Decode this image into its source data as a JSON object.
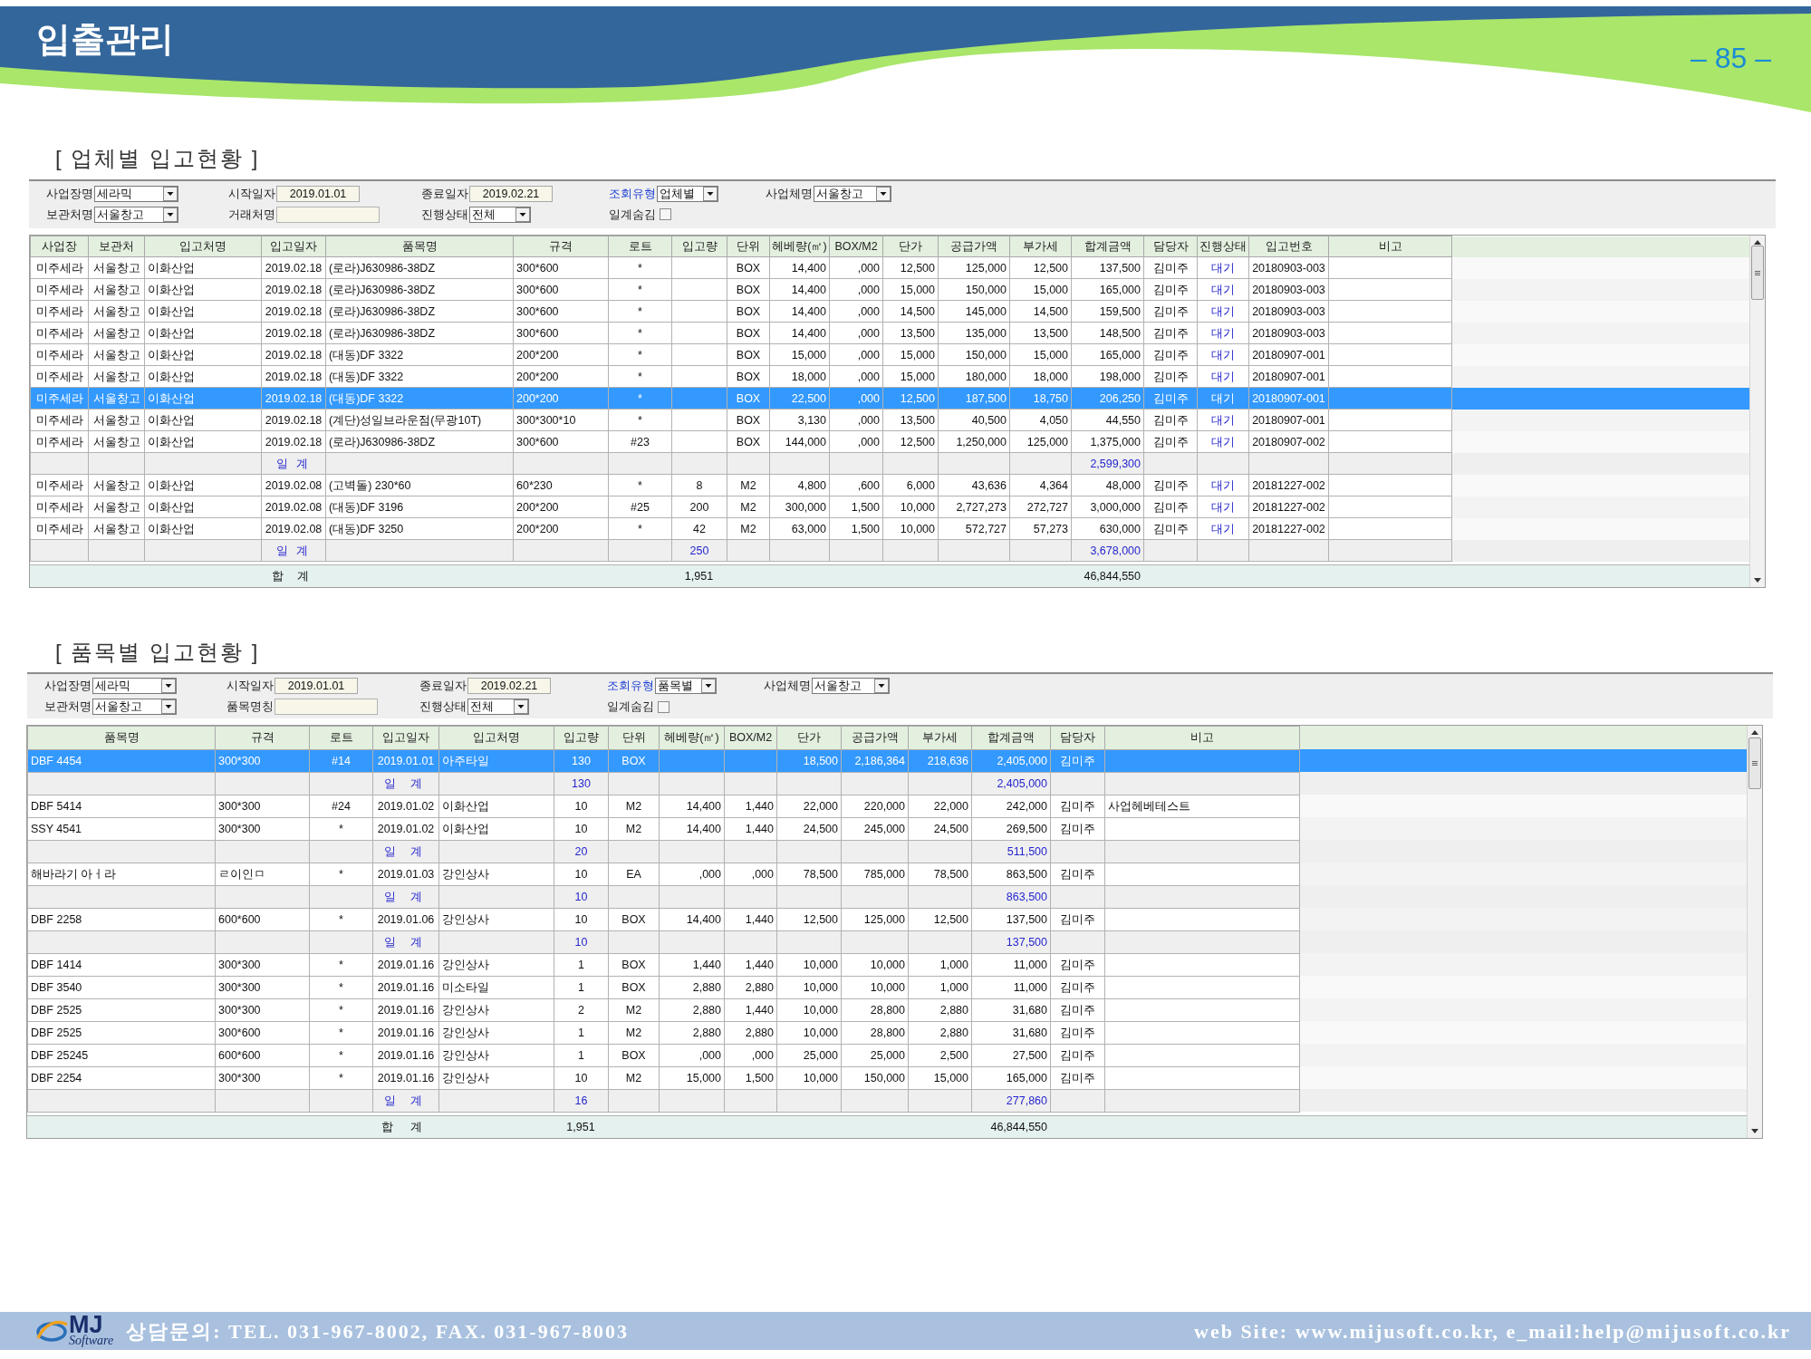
{
  "header": {
    "title": "입출관리",
    "page_number": "– 85 –"
  },
  "sections": [
    {
      "title": "[ 업체별 입고현황 ]",
      "filter_rows": [
        [
          {
            "label": "사업장명",
            "link": false,
            "kind": "select",
            "value": "세라믹"
          },
          {
            "label": "시작일자",
            "link": false,
            "kind": "date",
            "value": "2019.01.01"
          },
          {
            "label": "종료일자",
            "link": false,
            "kind": "date",
            "value": "2019.02.21"
          },
          {
            "label": "조회유형",
            "link": true,
            "kind": "select",
            "value": "업체별"
          },
          {
            "label": "사업체명",
            "link": false,
            "kind": "select",
            "value": "서울창고"
          }
        ],
        [
          {
            "label": "보관처명",
            "link": false,
            "kind": "select",
            "value": "서울창고"
          },
          {
            "label": "거래처명",
            "link": false,
            "kind": "text"
          },
          {
            "label": "진행상태",
            "link": false,
            "kind": "select",
            "value": "전체"
          },
          {
            "label": "일계숨김",
            "link": false,
            "kind": "checkbox",
            "checked": false
          }
        ]
      ],
      "table": {
        "columns": {
          "site": "사업장",
          "warehouse": "보관처",
          "supplier": "입고처명",
          "date": "입고일자",
          "item": "품목명",
          "spec": "규격",
          "lot": "로트",
          "qty": "입고량",
          "unit": "단위",
          "area": "헤베량(㎡)",
          "box_m2": "BOX/M2",
          "unit_price": "단가",
          "supply_amount": "공급가액",
          "vat": "부가세",
          "total_amount": "합계금액",
          "manager": "담당자",
          "status": "진행상태",
          "receipt_no": "입고번호",
          "note": "비고"
        },
        "rows": [
          {
            "kind": "item",
            "selected": false,
            "cells": {
              "site": "미주세라",
              "warehouse": "서울창고",
              "supplier": "이화산업",
              "date": "2019.02.18",
              "item": "(로라)J630986-38DZ",
              "spec": "300*600",
              "lot": "*",
              "unit": "BOX",
              "area": "14,400",
              "box_m2": ",000",
              "unit_price": "12,500",
              "supply_amount": "125,000",
              "vat": "12,500",
              "total_amount": "137,500",
              "manager": "김미주",
              "status": "대기",
              "receipt_no": "20180903-003"
            }
          },
          {
            "kind": "item",
            "selected": false,
            "cells": {
              "site": "미주세라",
              "warehouse": "서울창고",
              "supplier": "이화산업",
              "date": "2019.02.18",
              "item": "(로라)J630986-38DZ",
              "spec": "300*600",
              "lot": "*",
              "unit": "BOX",
              "area": "14,400",
              "box_m2": ",000",
              "unit_price": "15,000",
              "supply_amount": "150,000",
              "vat": "15,000",
              "total_amount": "165,000",
              "manager": "김미주",
              "status": "대기",
              "receipt_no": "20180903-003"
            }
          },
          {
            "kind": "item",
            "selected": false,
            "cells": {
              "site": "미주세라",
              "warehouse": "서울창고",
              "supplier": "이화산업",
              "date": "2019.02.18",
              "item": "(로라)J630986-38DZ",
              "spec": "300*600",
              "lot": "*",
              "unit": "BOX",
              "area": "14,400",
              "box_m2": ",000",
              "unit_price": "14,500",
              "supply_amount": "145,000",
              "vat": "14,500",
              "total_amount": "159,500",
              "manager": "김미주",
              "status": "대기",
              "receipt_no": "20180903-003"
            }
          },
          {
            "kind": "item",
            "selected": false,
            "cells": {
              "site": "미주세라",
              "warehouse": "서울창고",
              "supplier": "이화산업",
              "date": "2019.02.18",
              "item": "(로라)J630986-38DZ",
              "spec": "300*600",
              "lot": "*",
              "unit": "BOX",
              "area": "14,400",
              "box_m2": ",000",
              "unit_price": "13,500",
              "supply_amount": "135,000",
              "vat": "13,500",
              "total_amount": "148,500",
              "manager": "김미주",
              "status": "대기",
              "receipt_no": "20180903-003"
            }
          },
          {
            "kind": "item",
            "selected": false,
            "cells": {
              "site": "미주세라",
              "warehouse": "서울창고",
              "supplier": "이화산업",
              "date": "2019.02.18",
              "item": "(대동)DF 3322",
              "spec": "200*200",
              "lot": "*",
              "unit": "BOX",
              "area": "15,000",
              "box_m2": ",000",
              "unit_price": "15,000",
              "supply_amount": "150,000",
              "vat": "15,000",
              "total_amount": "165,000",
              "manager": "김미주",
              "status": "대기",
              "receipt_no": "20180907-001"
            }
          },
          {
            "kind": "item",
            "selected": false,
            "cells": {
              "site": "미주세라",
              "warehouse": "서울창고",
              "supplier": "이화산업",
              "date": "2019.02.18",
              "item": "(대동)DF 3322",
              "spec": "200*200",
              "lot": "*",
              "unit": "BOX",
              "area": "18,000",
              "box_m2": ",000",
              "unit_price": "15,000",
              "supply_amount": "180,000",
              "vat": "18,000",
              "total_amount": "198,000",
              "manager": "김미주",
              "status": "대기",
              "receipt_no": "20180907-001"
            }
          },
          {
            "kind": "item",
            "selected": true,
            "cells": {
              "site": "미주세라",
              "warehouse": "서울창고",
              "supplier": "이화산업",
              "date": "2019.02.18",
              "item": "(대동)DF 3322",
              "spec": "200*200",
              "lot": "*",
              "unit": "BOX",
              "area": "22,500",
              "box_m2": ",000",
              "unit_price": "12,500",
              "supply_amount": "187,500",
              "vat": "18,750",
              "total_amount": "206,250",
              "manager": "김미주",
              "status": "대기",
              "receipt_no": "20180907-001"
            }
          },
          {
            "kind": "item",
            "selected": false,
            "cells": {
              "site": "미주세라",
              "warehouse": "서울창고",
              "supplier": "이화산업",
              "date": "2019.02.18",
              "item": "(계단)성일브라운점(무광10T)",
              "spec": "300*300*10",
              "lot": "*",
              "unit": "BOX",
              "area": "3,130",
              "box_m2": ",000",
              "unit_price": "13,500",
              "supply_amount": "40,500",
              "vat": "4,050",
              "total_amount": "44,550",
              "manager": "김미주",
              "status": "대기",
              "receipt_no": "20180907-001"
            }
          },
          {
            "kind": "item",
            "selected": false,
            "cells": {
              "site": "미주세라",
              "warehouse": "서울창고",
              "supplier": "이화산업",
              "date": "2019.02.18",
              "item": "(로라)J630986-38DZ",
              "spec": "300*600",
              "lot": "#23",
              "unit": "BOX",
              "area": "144,000",
              "box_m2": ",000",
              "unit_price": "12,500",
              "supply_amount": "1,250,000",
              "vat": "125,000",
              "total_amount": "1,375,000",
              "manager": "김미주",
              "status": "대기",
              "receipt_no": "20180907-002"
            }
          },
          {
            "kind": "subtotal",
            "selected": false,
            "cells": {
              "date": "일 계",
              "total_amount": "2,599,300"
            }
          },
          {
            "kind": "item",
            "selected": false,
            "cells": {
              "site": "미주세라",
              "warehouse": "서울창고",
              "supplier": "이화산업",
              "date": "2019.02.08",
              "item": "(고벽돌) 230*60",
              "spec": "60*230",
              "lot": "*",
              "qty": "8",
              "unit": "M2",
              "area": "4,800",
              "box_m2": ",600",
              "unit_price": "6,000",
              "supply_amount": "43,636",
              "vat": "4,364",
              "total_amount": "48,000",
              "manager": "김미주",
              "status": "대기",
              "receipt_no": "20181227-002"
            }
          },
          {
            "kind": "item",
            "selected": false,
            "cells": {
              "site": "미주세라",
              "warehouse": "서울창고",
              "supplier": "이화산업",
              "date": "2019.02.08",
              "item": "(대동)DF 3196",
              "spec": "200*200",
              "lot": "#25",
              "qty": "200",
              "unit": "M2",
              "area": "300,000",
              "box_m2": "1,500",
              "unit_price": "10,000",
              "supply_amount": "2,727,273",
              "vat": "272,727",
              "total_amount": "3,000,000",
              "manager": "김미주",
              "status": "대기",
              "receipt_no": "20181227-002"
            }
          },
          {
            "kind": "item",
            "selected": false,
            "cells": {
              "site": "미주세라",
              "warehouse": "서울창고",
              "supplier": "이화산업",
              "date": "2019.02.08",
              "item": "(대동)DF 3250",
              "spec": "200*200",
              "lot": "*",
              "qty": "42",
              "unit": "M2",
              "area": "63,000",
              "box_m2": "1,500",
              "unit_price": "10,000",
              "supply_amount": "572,727",
              "vat": "57,273",
              "total_amount": "630,000",
              "manager": "김미주",
              "status": "대기",
              "receipt_no": "20181227-002"
            }
          },
          {
            "kind": "subtotal",
            "selected": false,
            "cells": {
              "date": "일 계",
              "qty": "250",
              "total_amount": "3,678,000"
            }
          }
        ],
        "total": {
          "date": "합 계",
          "qty": "1,951",
          "total_amount": "46,844,550"
        }
      }
    },
    {
      "title": "[ 품목별 입고현황 ]",
      "filter_rows": [
        [
          {
            "label": "사업장명",
            "link": false,
            "kind": "select",
            "value": "세라믹"
          },
          {
            "label": "시작일자",
            "link": false,
            "kind": "date",
            "value": "2019.01.01"
          },
          {
            "label": "종료일자",
            "link": false,
            "kind": "date",
            "value": "2019.02.21"
          },
          {
            "label": "조회유형",
            "link": true,
            "kind": "select",
            "value": "품목별"
          },
          {
            "label": "사업체명",
            "link": false,
            "kind": "select",
            "value": "서울창고"
          }
        ],
        [
          {
            "label": "보관처명",
            "link": false,
            "kind": "select",
            "value": "서울창고"
          },
          {
            "label": "품목명칭",
            "link": false,
            "kind": "text"
          },
          {
            "label": "진행상태",
            "link": false,
            "kind": "select",
            "value": "전체"
          },
          {
            "label": "일계숨김",
            "link": false,
            "kind": "checkbox",
            "checked": false
          }
        ]
      ],
      "table": {
        "columns": {
          "item": "품목명",
          "spec": "규격",
          "lot": "로트",
          "date": "입고일자",
          "supplier": "입고처명",
          "qty": "입고량",
          "unit": "단위",
          "area": "헤베량(㎡)",
          "box_m2": "BOX/M2",
          "unit_price": "단가",
          "supply_amount": "공급가액",
          "vat": "부가세",
          "total_amount": "합계금액",
          "manager": "담당자",
          "note": "비고"
        },
        "rows": [
          {
            "kind": "item",
            "selected": true,
            "cells": {
              "item": "DBF 4454",
              "spec": "300*300",
              "lot": "#14",
              "date": "2019.01.01",
              "supplier": "아주타일",
              "qty": "130",
              "unit": "BOX",
              "unit_price": "18,500",
              "supply_amount": "2,186,364",
              "vat": "218,636",
              "total_amount": "2,405,000",
              "manager": "김미주"
            }
          },
          {
            "kind": "subtotal",
            "selected": false,
            "cells": {
              "date": "일 계",
              "qty": "130",
              "total_amount": "2,405,000"
            }
          },
          {
            "kind": "item",
            "selected": false,
            "cells": {
              "item": "DBF 5414",
              "spec": "300*300",
              "lot": "#24",
              "date": "2019.01.02",
              "supplier": "이화산업",
              "qty": "10",
              "unit": "M2",
              "area": "14,400",
              "box_m2": "1,440",
              "unit_price": "22,000",
              "supply_amount": "220,000",
              "vat": "22,000",
              "total_amount": "242,000",
              "manager": "김미주",
              "note": "사업헤베테스트"
            }
          },
          {
            "kind": "item",
            "selected": false,
            "cells": {
              "item": "SSY 4541",
              "spec": "300*300",
              "lot": "*",
              "date": "2019.01.02",
              "supplier": "이화산업",
              "qty": "10",
              "unit": "M2",
              "area": "14,400",
              "box_m2": "1,440",
              "unit_price": "24,500",
              "supply_amount": "245,000",
              "vat": "24,500",
              "total_amount": "269,500",
              "manager": "김미주"
            }
          },
          {
            "kind": "subtotal",
            "selected": false,
            "cells": {
              "date": "일 계",
              "qty": "20",
              "total_amount": "511,500"
            }
          },
          {
            "kind": "item",
            "selected": false,
            "cells": {
              "item": "해바라기 아ㅓ라",
              "spec": "ㄹ이인ㅁ",
              "lot": "*",
              "date": "2019.01.03",
              "supplier": "강인상사",
              "qty": "10",
              "unit": "EA",
              "area": ",000",
              "box_m2": ",000",
              "unit_price": "78,500",
              "supply_amount": "785,000",
              "vat": "78,500",
              "total_amount": "863,500",
              "manager": "김미주"
            }
          },
          {
            "kind": "subtotal",
            "selected": false,
            "cells": {
              "date": "일 계",
              "qty": "10",
              "total_amount": "863,500"
            }
          },
          {
            "kind": "item",
            "selected": false,
            "cells": {
              "item": "DBF 2258",
              "spec": "600*600",
              "lot": "*",
              "date": "2019.01.06",
              "supplier": "강인상사",
              "qty": "10",
              "unit": "BOX",
              "area": "14,400",
              "box_m2": "1,440",
              "unit_price": "12,500",
              "supply_amount": "125,000",
              "vat": "12,500",
              "total_amount": "137,500",
              "manager": "김미주"
            }
          },
          {
            "kind": "subtotal",
            "selected": false,
            "cells": {
              "date": "일 계",
              "qty": "10",
              "total_amount": "137,500"
            }
          },
          {
            "kind": "item",
            "selected": false,
            "cells": {
              "item": "DBF 1414",
              "spec": "300*300",
              "lot": "*",
              "date": "2019.01.16",
              "supplier": "강인상사",
              "qty": "1",
              "unit": "BOX",
              "area": "1,440",
              "box_m2": "1,440",
              "unit_price": "10,000",
              "supply_amount": "10,000",
              "vat": "1,000",
              "total_amount": "11,000",
              "manager": "김미주"
            }
          },
          {
            "kind": "item",
            "selected": false,
            "cells": {
              "item": "DBF 3540",
              "spec": "300*300",
              "lot": "*",
              "date": "2019.01.16",
              "supplier": "미소타일",
              "qty": "1",
              "unit": "BOX",
              "area": "2,880",
              "box_m2": "2,880",
              "unit_price": "10,000",
              "supply_amount": "10,000",
              "vat": "1,000",
              "total_amount": "11,000",
              "manager": "김미주"
            }
          },
          {
            "kind": "item",
            "selected": false,
            "cells": {
              "item": "DBF 2525",
              "spec": "300*300",
              "lot": "*",
              "date": "2019.01.16",
              "supplier": "강인상사",
              "qty": "2",
              "unit": "M2",
              "area": "2,880",
              "box_m2": "1,440",
              "unit_price": "10,000",
              "supply_amount": "28,800",
              "vat": "2,880",
              "total_amount": "31,680",
              "manager": "김미주"
            }
          },
          {
            "kind": "item",
            "selected": false,
            "cells": {
              "item": "DBF 2525",
              "spec": "300*600",
              "lot": "*",
              "date": "2019.01.16",
              "supplier": "강인상사",
              "qty": "1",
              "unit": "M2",
              "area": "2,880",
              "box_m2": "2,880",
              "unit_price": "10,000",
              "supply_amount": "28,800",
              "vat": "2,880",
              "total_amount": "31,680",
              "manager": "김미주"
            }
          },
          {
            "kind": "item",
            "selected": false,
            "cells": {
              "item": "DBF 25245",
              "spec": "600*600",
              "lot": "*",
              "date": "2019.01.16",
              "supplier": "강인상사",
              "qty": "1",
              "unit": "BOX",
              "area": ",000",
              "box_m2": ",000",
              "unit_price": "25,000",
              "supply_amount": "25,000",
              "vat": "2,500",
              "total_amount": "27,500",
              "manager": "김미주"
            }
          },
          {
            "kind": "item",
            "selected": false,
            "cells": {
              "item": "DBF 2254",
              "spec": "300*300",
              "lot": "*",
              "date": "2019.01.16",
              "supplier": "강인상사",
              "qty": "10",
              "unit": "M2",
              "area": "15,000",
              "box_m2": "1,500",
              "unit_price": "10,000",
              "supply_amount": "150,000",
              "vat": "15,000",
              "total_amount": "165,000",
              "manager": "김미주"
            }
          },
          {
            "kind": "subtotal",
            "selected": false,
            "cells": {
              "date": "일 계",
              "qty": "16",
              "total_amount": "277,860"
            }
          }
        ],
        "total": {
          "date": "합 계",
          "qty": "1,951",
          "total_amount": "46,844,550"
        }
      }
    }
  ],
  "footer": {
    "logo_name": "MJ",
    "logo_tagline": "Software",
    "contact": "상담문의: TEL. 031-967-8002, FAX. 031-967-8003",
    "website": "web Site: www.mijusoft.co.kr, e_mail:help@mijusoft.co.kr"
  }
}
